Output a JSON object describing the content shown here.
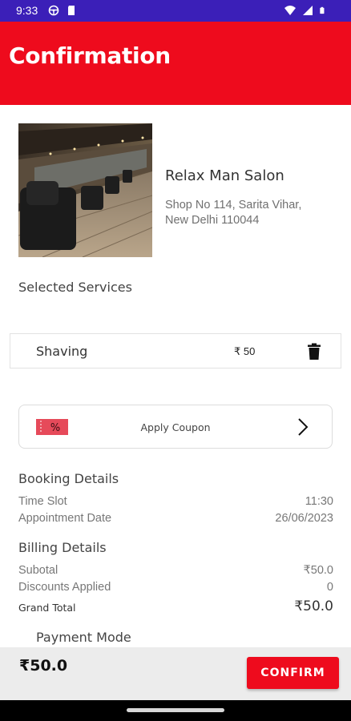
{
  "status_bar": {
    "time": "9:33",
    "left_icons": [
      "steering-wheel-icon",
      "sd-card-icon"
    ],
    "right_icons": [
      "wifi-icon",
      "signal-icon",
      "battery-icon"
    ],
    "background": "#3b1fb8"
  },
  "header": {
    "title": "Confirmation",
    "background": "#ee0b1d"
  },
  "salon": {
    "name": "Relax Man Salon",
    "address_line1": "Shop No 114, Sarita Vihar,",
    "address_line2": "New Delhi 110044"
  },
  "services": {
    "heading": "Selected Services",
    "items": [
      {
        "name": "Shaving",
        "price": "₹ 50"
      }
    ]
  },
  "coupon": {
    "label": "Apply Coupon",
    "icon": "coupon-ticket-icon"
  },
  "booking": {
    "heading": "Booking Details",
    "time_slot_label": "Time Slot",
    "time_slot_value": "11:30",
    "date_label": "Appointment Date",
    "date_value": "26/06/2023"
  },
  "billing": {
    "heading": "Billing Details",
    "subtotal_label": "Subotal",
    "subtotal_value": "₹50.0",
    "discounts_label": "Discounts Applied",
    "discounts_value": "0",
    "grand_total_label": "Grand Total",
    "grand_total_value": "₹50.0"
  },
  "payment": {
    "heading": "Payment Mode"
  },
  "bottom_bar": {
    "total": "₹50.0",
    "confirm_label": "CONFIRM"
  },
  "colors": {
    "accent": "#ee0b1d",
    "status_bar": "#3b1fb8"
  }
}
